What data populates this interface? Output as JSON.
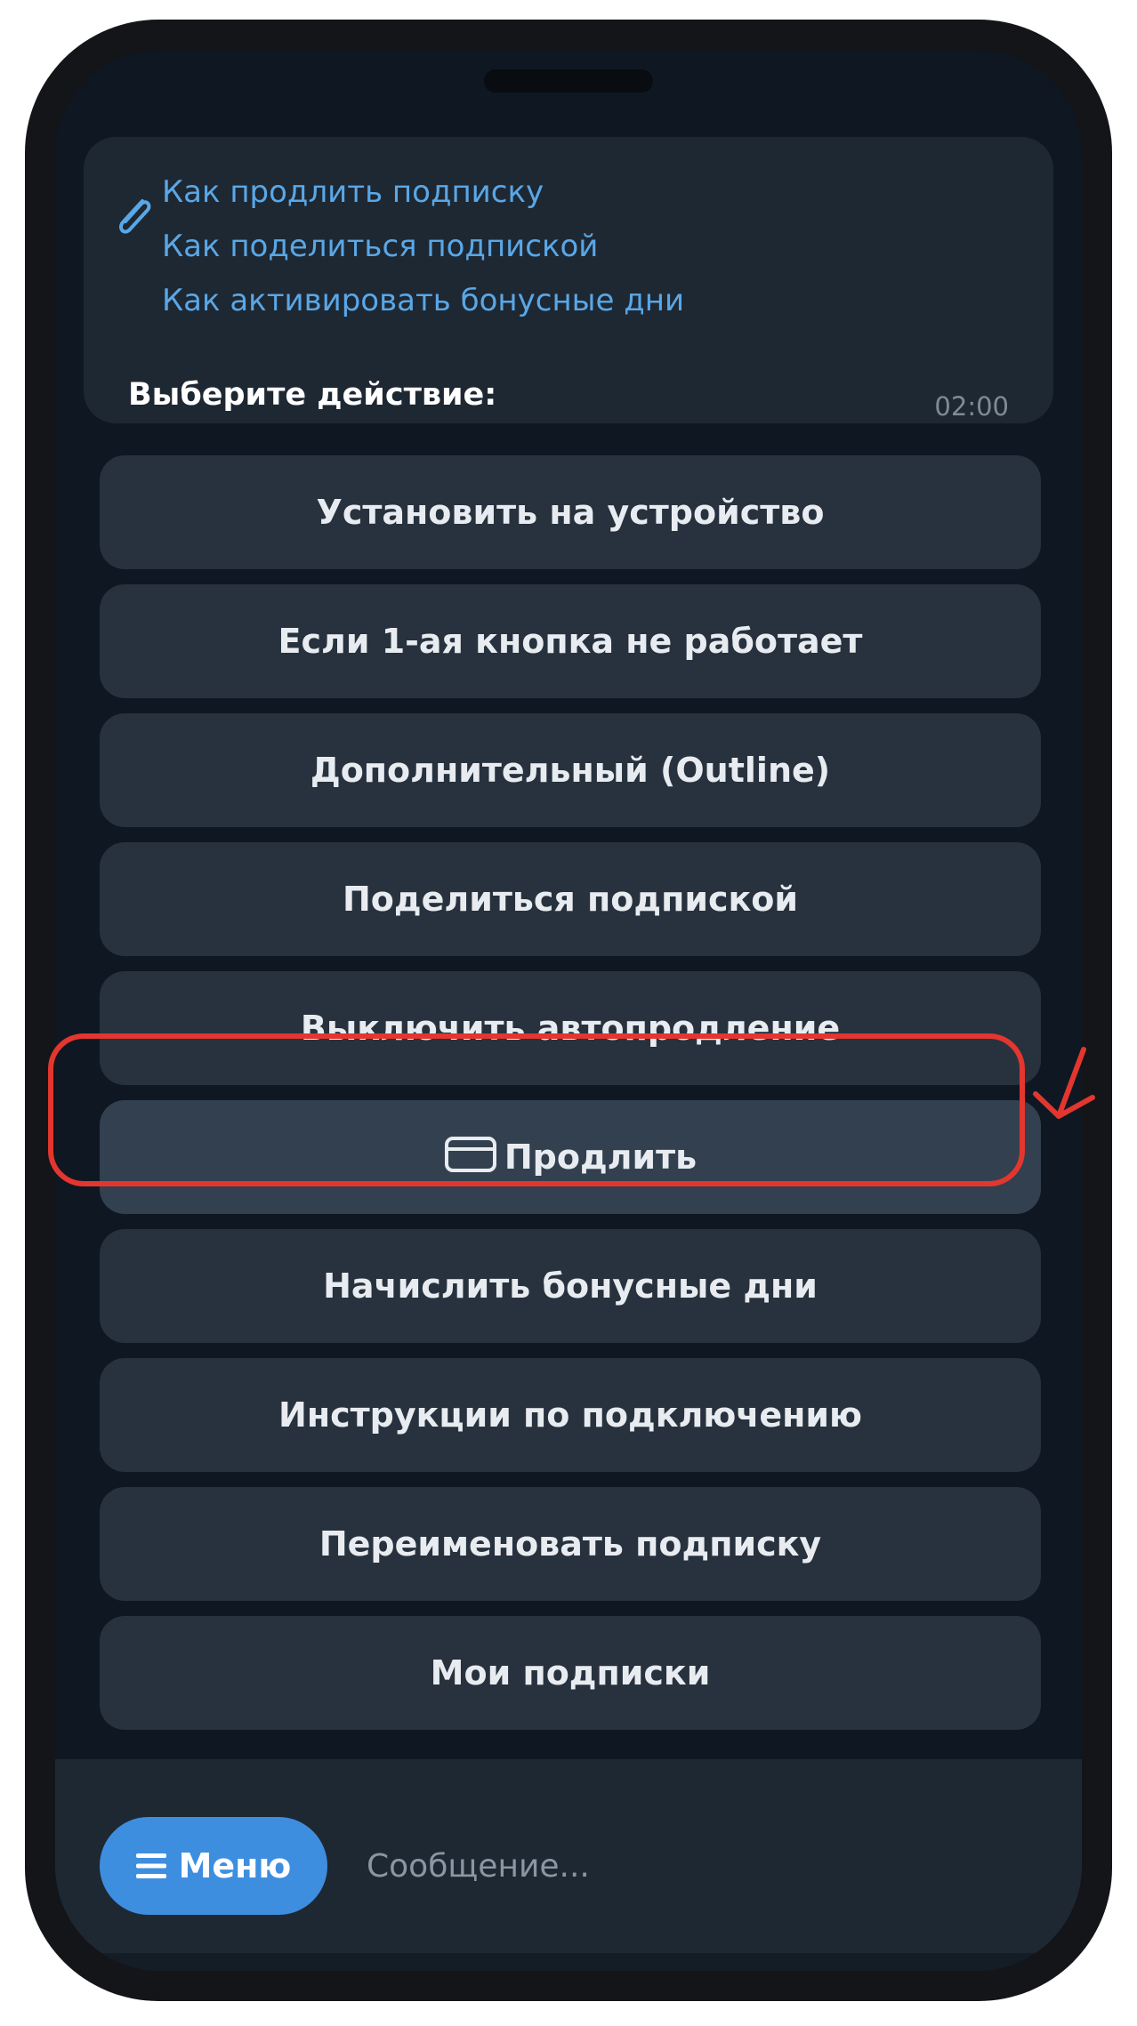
{
  "message": {
    "links": [
      "Как продлить подписку",
      "Как поделиться подпиской",
      "Как активировать бонусные дни"
    ],
    "text": "Выберите действие:",
    "time": "02:00"
  },
  "keyboard": {
    "buttons": [
      "Установить на устройство",
      "Если 1-ая кнопка не работает",
      "Дополнительный (Outline)",
      "Поделиться подпиской",
      "Выключить автопродление",
      "Продлить",
      "Начислить бонусные дни",
      "Инструкции по подключению",
      "Переименовать подписку",
      "Мои подписки"
    ],
    "highlighted_index": 5
  },
  "input_bar": {
    "menu_label": "Меню",
    "placeholder": "Сообщение..."
  },
  "colors": {
    "link": "#5aa7e6",
    "menu_button": "#3e8ee0",
    "highlight": "#e3362f"
  },
  "icons": {
    "attachment": "paperclip-icon",
    "renew": "credit-card-icon",
    "menu": "hamburger-icon"
  }
}
